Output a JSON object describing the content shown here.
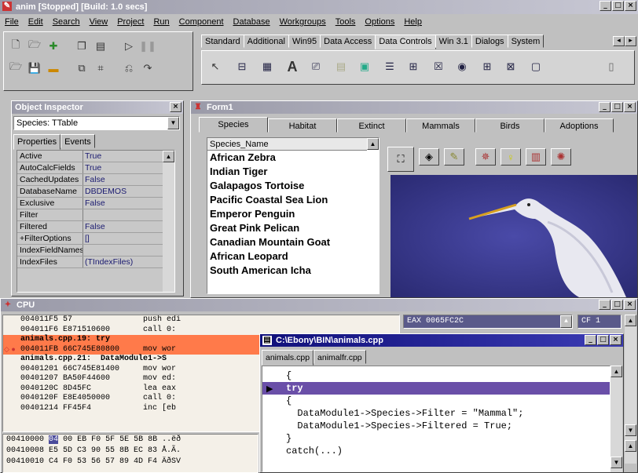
{
  "app": {
    "title": "anim [Stopped] [Build: 1.0 secs]",
    "menu": [
      "File",
      "Edit",
      "Search",
      "View",
      "Project",
      "Run",
      "Component",
      "Database",
      "Workgroups",
      "Tools",
      "Options",
      "Help"
    ]
  },
  "palette": {
    "tabs": [
      "Standard",
      "Additional",
      "Win95",
      "Data Access",
      "Data Controls",
      "Win 3.1",
      "Dialogs",
      "System"
    ],
    "selected_tab": "Data Controls"
  },
  "object_inspector": {
    "title": "Object Inspector",
    "selected_object": "Species: TTable",
    "tabs": [
      "Properties",
      "Events"
    ],
    "properties": [
      {
        "k": "Active",
        "v": "True"
      },
      {
        "k": "AutoCalcFields",
        "v": "True"
      },
      {
        "k": "CachedUpdates",
        "v": "False"
      },
      {
        "k": "DatabaseName",
        "v": "DBDEMOS"
      },
      {
        "k": "Exclusive",
        "v": "False"
      },
      {
        "k": "Filter",
        "v": ""
      },
      {
        "k": "Filtered",
        "v": "False"
      },
      {
        "k": "+FilterOptions",
        "v": "[]"
      },
      {
        "k": "IndexFieldNames",
        "v": ""
      },
      {
        "k": "IndexFiles",
        "v": "(TIndexFiles)"
      }
    ]
  },
  "form1": {
    "title": "Form1",
    "tabs": [
      "Species",
      "Habitat",
      "Extinct",
      "Mammals",
      "Birds",
      "Adoptions"
    ],
    "selected_tab": "Species",
    "list_header": "Species_Name",
    "species": [
      "African Zebra",
      "Indian Tiger",
      "Galapagos Tortoise",
      "Pacific Coastal Sea Lion",
      "Emperor Penguin",
      "Great Pink Pelican",
      "Canadian Mountain Goat",
      "African Leopard",
      "South American Icha"
    ],
    "toolbar_icons": [
      "shapes-icon",
      "eraser-icon",
      "pencil-icon",
      "sparkle-icon",
      "bulb-icon",
      "chart-icon",
      "burst-icon"
    ]
  },
  "cpu": {
    "title": "CPU",
    "disasm": [
      {
        "text": "004011F5 57               push edi",
        "hl": false
      },
      {
        "text": "004011F6 E871510600       call 0:",
        "hl": false
      },
      {
        "text": "animals.cpp.19: try",
        "hl": true
      },
      {
        "text": "004011FB 66C745E80800     mov wor",
        "hl": true
      },
      {
        "text": "animals.cpp.21:  DataModule1->S",
        "hl": false
      },
      {
        "text": "00401201 66C745E81400     mov wor",
        "hl": false
      },
      {
        "text": "00401207 BA50F44600       mov ed:",
        "hl": false
      },
      {
        "text": "0040120C 8D45FC           lea eax",
        "hl": false
      },
      {
        "text": "0040120F E8E4050000       call 0:",
        "hl": false
      },
      {
        "text": "00401214 FF45F4           inc [eb",
        "hl": false
      }
    ],
    "dump": [
      {
        "addr": "00410000",
        "sel": "04",
        "rest": "00 EB F0 5F 5E 5B 8B ..ëð"
      },
      {
        "addr": "00410008",
        "sel": "",
        "rest": "E5 5D C3 90 55 8B EC 83 Å.Ã."
      },
      {
        "addr": "00410010",
        "sel": "",
        "rest": "C4 F0 53 56 57 89 4D F4 ÄðSV"
      }
    ],
    "registers": {
      "eax": "EAX 0065FC2C",
      "cf": "CF 1"
    }
  },
  "editor": {
    "title": "C:\\Ebony\\BIN\\animals.cpp",
    "tabs": [
      "animals.cpp",
      "animalfr.cpp"
    ],
    "lines": [
      {
        "text": "{",
        "exec": false
      },
      {
        "text": "try",
        "exec": true
      },
      {
        "text": "{",
        "exec": false
      },
      {
        "text": "  DataModule1->Species->Filter = \"Mammal\";",
        "exec": false
      },
      {
        "text": "  DataModule1->Species->Filtered = True;",
        "exec": false
      },
      {
        "text": "}",
        "exec": false
      },
      {
        "text": "catch(...)",
        "exec": false
      }
    ]
  },
  "colors": {
    "titlebar": "#7a7aa6",
    "cpu_highlight": "#ff7a4a",
    "exec_line": "#6a4fa8",
    "photo_bg": "#3a3a8c"
  }
}
